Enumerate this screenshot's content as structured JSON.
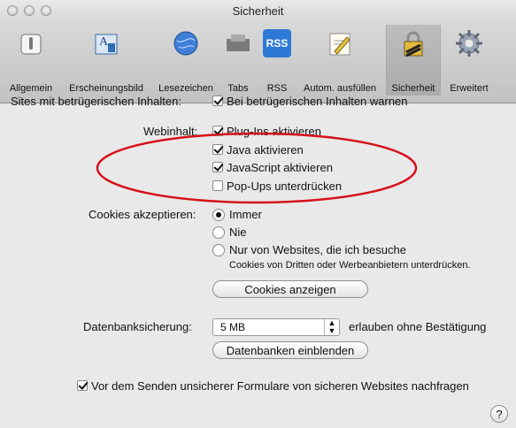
{
  "window": {
    "title": "Sicherheit"
  },
  "toolbar": {
    "items": [
      {
        "label": "Allgemein",
        "icon": "general-switch-icon"
      },
      {
        "label": "Erscheinungsbild",
        "icon": "appearance-font-icon"
      },
      {
        "label": "Lesezeichen",
        "icon": "bookmarks-globe-icon"
      },
      {
        "label": "Tabs",
        "icon": "tabs-icon"
      },
      {
        "label": "RSS",
        "icon": "rss-icon",
        "badge": "RSS"
      },
      {
        "label": "Autom. ausfüllen",
        "icon": "autofill-pencil-icon"
      },
      {
        "label": "Sicherheit",
        "icon": "security-lock-icon",
        "selected": true
      },
      {
        "label": "Erweitert",
        "icon": "advanced-gear-icon"
      }
    ]
  },
  "fraud": {
    "label": "Sites mit betrügerischen Inhalten:",
    "checkbox_label": "Bei betrügerischen Inhalten warnen",
    "checked": true
  },
  "web_content": {
    "label": "Webinhalt:",
    "options": [
      {
        "label": "Plug-Ins aktivieren",
        "checked": true
      },
      {
        "label": "Java aktivieren",
        "checked": true
      },
      {
        "label": "JavaScript aktivieren",
        "checked": true
      },
      {
        "label": "Pop-Ups unterdrücken",
        "checked": false
      }
    ],
    "highlight_color": "#d6101b"
  },
  "cookies": {
    "label": "Cookies akzeptieren:",
    "options": [
      {
        "label": "Immer",
        "selected": true
      },
      {
        "label": "Nie",
        "selected": false
      },
      {
        "label": "Nur von Websites, die ich besuche",
        "selected": false
      }
    ],
    "note": "Cookies von Dritten oder Werbeanbietern unterdrücken.",
    "show_button": "Cookies anzeigen"
  },
  "database": {
    "label": "Datenbanksicherung:",
    "value": "5 MB",
    "suffix": "erlauben ohne Bestätigung",
    "show_button": "Datenbanken einblenden"
  },
  "forms": {
    "label": "Vor dem Senden unsicherer Formulare von sicheren Websites nachfragen",
    "checked": true
  },
  "help": {
    "label": "?"
  }
}
